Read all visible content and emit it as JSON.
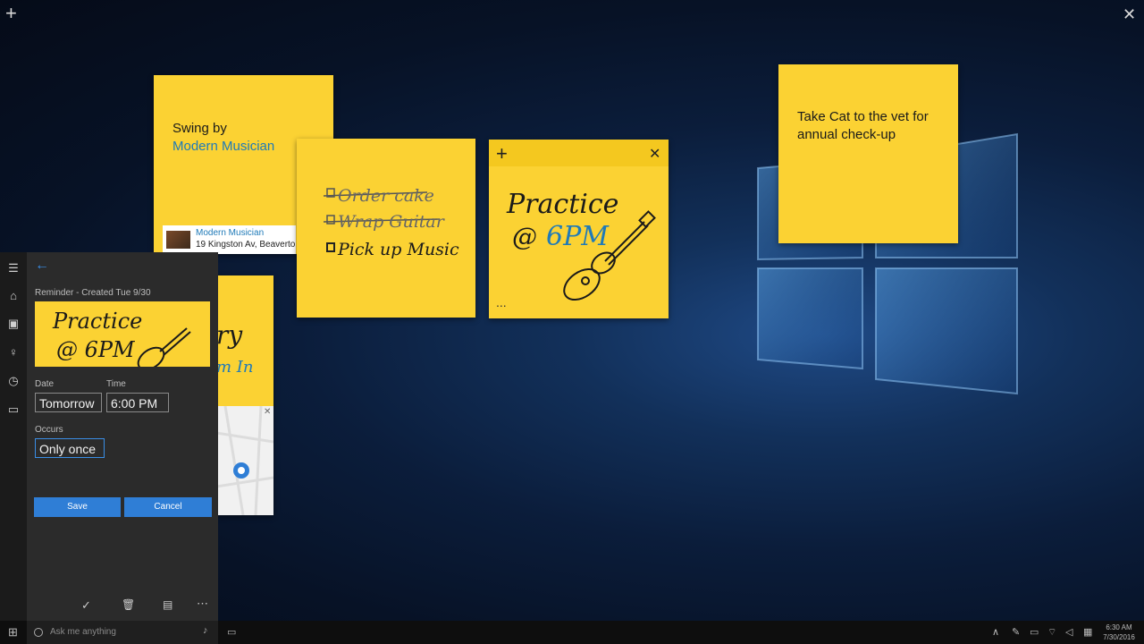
{
  "window": {
    "add_icon": "plus-icon",
    "close_icon": "close-icon"
  },
  "notes": {
    "musician": {
      "line1": "Swing by",
      "link": "Modern Musician",
      "card_title": "Modern Musician",
      "card_address": "19 Kingston Av, Beaverto"
    },
    "checklist": {
      "items": [
        "Order cake",
        "Wrap Guitar",
        "Pick up Music"
      ]
    },
    "practice": {
      "word1": "Practice",
      "word2": "@",
      "word3": "6PM",
      "more": "..."
    },
    "vet": {
      "line1": "Take Cat to the vet for",
      "line2": "annual check-up"
    },
    "partial": {
      "text1": "ry",
      "text2": "m In"
    }
  },
  "reminder": {
    "header": "Reminder - Created Tue 9/30",
    "date_label": "Date",
    "date_value": "Tomorrow",
    "time_label": "Time",
    "time_value": "6:00 PM",
    "occurs_label": "Occurs",
    "occurs_value": "Only once",
    "save": "Save",
    "cancel": "Cancel",
    "preview": {
      "word1": "Practice",
      "word2": "@ 6PM"
    }
  },
  "taskbar": {
    "search_placeholder": "Ask me anything",
    "time": "6:30 AM",
    "date": "7/30/2016"
  },
  "colors": {
    "note_yellow": "#fbd233",
    "accent_blue": "#2f7ed6",
    "ink_blue": "#1f7ab8"
  }
}
